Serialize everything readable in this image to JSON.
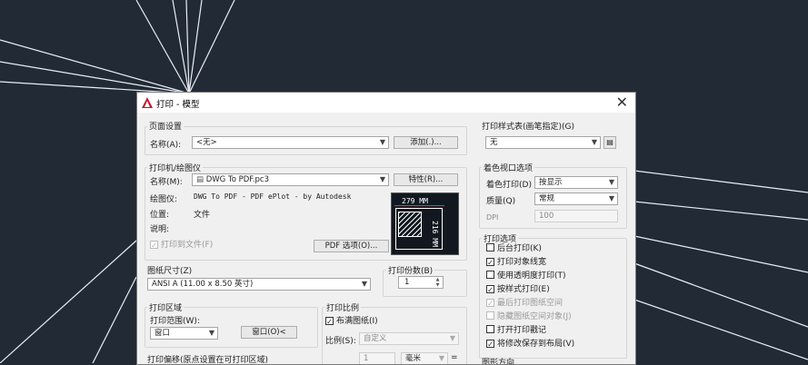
{
  "dialog": {
    "title": "打印 - 模型",
    "page_setup": {
      "section": "页面设置",
      "name_label": "名称(A):",
      "name_value": "<无>",
      "add_button": "添加(.)..."
    },
    "printer": {
      "section": "打印机/绘图仪",
      "name_label": "名称(M):",
      "name_value": "DWG To PDF.pc3",
      "properties_button": "特性(R)...",
      "plotter_label": "绘图仪:",
      "plotter_value": "DWG To PDF - PDF ePlot - by Autodesk",
      "location_label": "位置:",
      "location_value": "文件",
      "desc_label": "说明:",
      "print_to_file": "打印到文件(F)",
      "pdf_options_button": "PDF 选项(O)...",
      "preview_width": "279 MM",
      "preview_height": "216 MM"
    },
    "paper_size": {
      "section": "图纸尺寸(Z)",
      "value": "ANSI A (11.00 x 8.50 英寸)"
    },
    "copies": {
      "section": "打印份数(B)",
      "value": "1"
    },
    "print_area": {
      "section": "打印区域",
      "range_label": "打印范围(W):",
      "range_value": "窗口",
      "window_button": "窗口(O)<"
    },
    "print_scale": {
      "section": "打印比例",
      "fit_to_paper": "布满图纸(I)",
      "scale_label": "比例(S):",
      "scale_value": "自定义",
      "scale_number": "1",
      "unit_value": "毫米"
    },
    "plot_offset": {
      "section": "打印偏移(原点设置在可打印区域)"
    },
    "plot_style_table": {
      "section": "打印样式表(画笔指定)(G)",
      "value": "无"
    },
    "shaded_viewport": {
      "section": "着色视口选项",
      "shade_label": "着色打印(D)",
      "shade_value": "按显示",
      "quality_label": "质量(Q)",
      "quality_value": "常规",
      "dpi_label": "DPI",
      "dpi_value": "100"
    },
    "plot_options": {
      "section": "打印选项",
      "items": [
        {
          "label": "后台打印(K)",
          "checked": false,
          "disabled": false
        },
        {
          "label": "打印对象线宽",
          "checked": true,
          "disabled": false
        },
        {
          "label": "使用透明度打印(T)",
          "checked": false,
          "disabled": false
        },
        {
          "label": "按样式打印(E)",
          "checked": true,
          "disabled": false
        },
        {
          "label": "最后打印图纸空间",
          "checked": true,
          "disabled": true
        },
        {
          "label": "隐藏图纸空间对象(J)",
          "checked": false,
          "disabled": true
        },
        {
          "label": "打开打印戳记",
          "checked": false,
          "disabled": false
        },
        {
          "label": "将修改保存到布局(V)",
          "checked": true,
          "disabled": false
        }
      ]
    },
    "orientation": {
      "section": "图形方向"
    }
  }
}
